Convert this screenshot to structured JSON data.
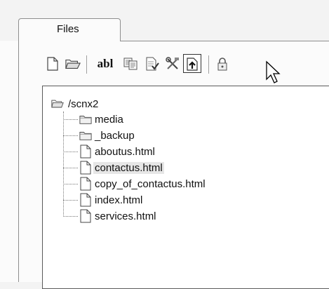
{
  "panel": {
    "tab_label": "Files"
  },
  "toolbar": {
    "buttons": [
      {
        "name": "new-file-icon"
      },
      {
        "name": "open-folder-icon"
      },
      {
        "name": "rename-button",
        "label": "abl"
      },
      {
        "name": "copy-icon"
      },
      {
        "name": "check-in-icon"
      },
      {
        "name": "tools-icon"
      },
      {
        "name": "upload-icon"
      },
      {
        "name": "lock-icon"
      }
    ]
  },
  "tree": {
    "root": "/scnx2",
    "items": [
      {
        "label": "media",
        "type": "folder"
      },
      {
        "label": "_backup",
        "type": "folder"
      },
      {
        "label": "aboutus.html",
        "type": "file"
      },
      {
        "label": "contactus.html",
        "type": "file",
        "selected": true
      },
      {
        "label": "copy_of_contactus.html",
        "type": "file"
      },
      {
        "label": "index.html",
        "type": "file"
      },
      {
        "label": "services.html",
        "type": "file"
      }
    ]
  },
  "colors": {
    "background": "#f3f3f3",
    "panel": "#fbfbfb",
    "selection": "#e6e6e6",
    "border": "#8e8e8e"
  }
}
